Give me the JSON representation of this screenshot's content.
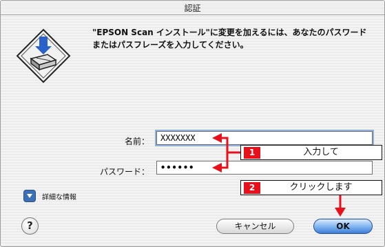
{
  "window": {
    "title": "認証",
    "message": "\"EPSON Scan インストール\"に変更を加えるには、あなたのパスワードまたはパスフレーズを入力してください。"
  },
  "form": {
    "name_label": "名前：",
    "name_value": "XXXXXXX",
    "password_label": "パスワード：",
    "password_value": "••••••"
  },
  "details": {
    "label": "詳細な情報"
  },
  "buttons": {
    "help": "?",
    "cancel": "キャンセル",
    "ok": "OK"
  },
  "annotations": [
    {
      "number": "1",
      "text": "入力して"
    },
    {
      "number": "2",
      "text": "クリックします"
    }
  ],
  "colors": {
    "annotation_accent": "#e8111b",
    "ok_button": "#3e7ed5",
    "focus_ring": "#8fb1d9"
  },
  "icons": {
    "app": "scanner-install-icon",
    "disclosure": "disclosure-triangle-icon"
  }
}
